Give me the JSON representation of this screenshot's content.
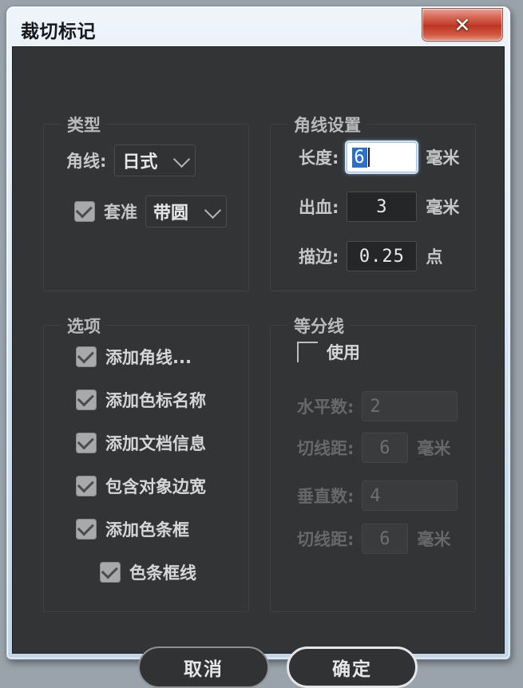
{
  "window": {
    "title": "裁切标记",
    "close_label": "✕",
    "frame_color": "#cfdfee",
    "body_color": "#333436",
    "close_color": "#c23f2b"
  },
  "groups": {
    "type": {
      "title": "类型",
      "corner_line": {
        "label": "角线:",
        "value": "日式"
      },
      "registration": {
        "checkbox_label": "套准",
        "checked": true,
        "value": "带圆"
      }
    },
    "corner_settings": {
      "title": "角线设置",
      "fields": [
        {
          "label": "长度:",
          "value": "6",
          "unit": "毫米",
          "focused": true
        },
        {
          "label": "出血:",
          "value": "3",
          "unit": "毫米",
          "focused": false
        },
        {
          "label": "描边:",
          "value": "0.25",
          "unit": "点",
          "focused": false
        }
      ]
    },
    "options": {
      "title": "选项",
      "items": [
        {
          "label": "添加角线...",
          "checked": true,
          "indented": false
        },
        {
          "label": "添加色标名称",
          "checked": true,
          "indented": false
        },
        {
          "label": "添加文档信息",
          "checked": true,
          "indented": false
        },
        {
          "label": "包含对象边宽",
          "checked": true,
          "indented": false
        },
        {
          "label": "添加色条框",
          "checked": true,
          "indented": false
        },
        {
          "label": "色条框线",
          "checked": true,
          "indented": true
        }
      ]
    },
    "divider_lines": {
      "title": "等分线",
      "enable": {
        "label": "使用",
        "checked": false
      },
      "disabled": true,
      "fields": [
        {
          "label": "水平数:",
          "value": "2",
          "unit": ""
        },
        {
          "label": "切线距:",
          "value": "6",
          "unit": "毫米"
        },
        {
          "label": "垂直数:",
          "value": "4",
          "unit": ""
        },
        {
          "label": "切线距:",
          "value": "6",
          "unit": "毫米"
        }
      ]
    }
  },
  "buttons": {
    "cancel": "取消",
    "ok": "确定"
  }
}
